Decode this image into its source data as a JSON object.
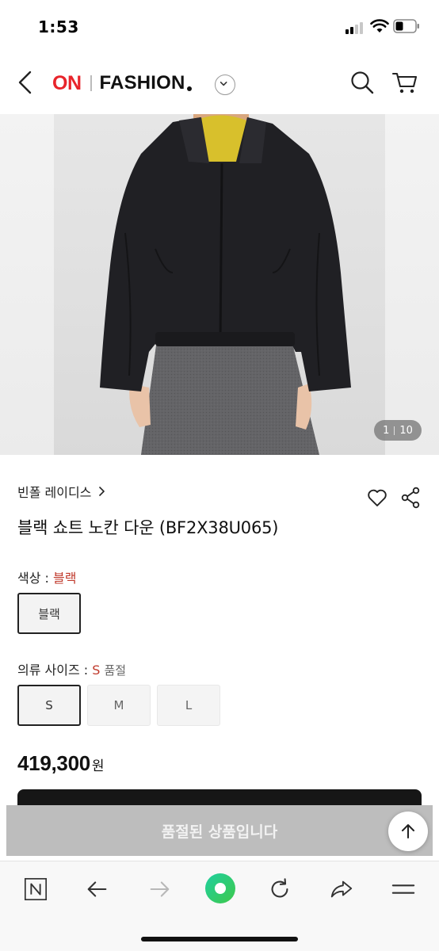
{
  "status_bar": {
    "time": "1:53"
  },
  "header": {
    "logo_on": "ON",
    "logo_fashion": "FASHION"
  },
  "gallery": {
    "current": "1",
    "total": "10"
  },
  "product": {
    "brand": "빈폴 레이디스",
    "title": "블랙 쇼트 노칸 다운 (BF2X38U065)",
    "color_option": {
      "label": "색상 : ",
      "selected": "블랙",
      "options": [
        "블랙"
      ]
    },
    "size_option": {
      "label": "의류 사이즈 : ",
      "selected": "S",
      "status": "품절",
      "options": [
        "S",
        "M",
        "L"
      ]
    },
    "price": "419,300",
    "price_unit": "원"
  },
  "cta": {
    "soldout_label": "품절된 상품입니다"
  },
  "colors": {
    "brand_red": "#e8242b",
    "selected_text": "#c0392b",
    "naver_green": "#2bd07a"
  }
}
